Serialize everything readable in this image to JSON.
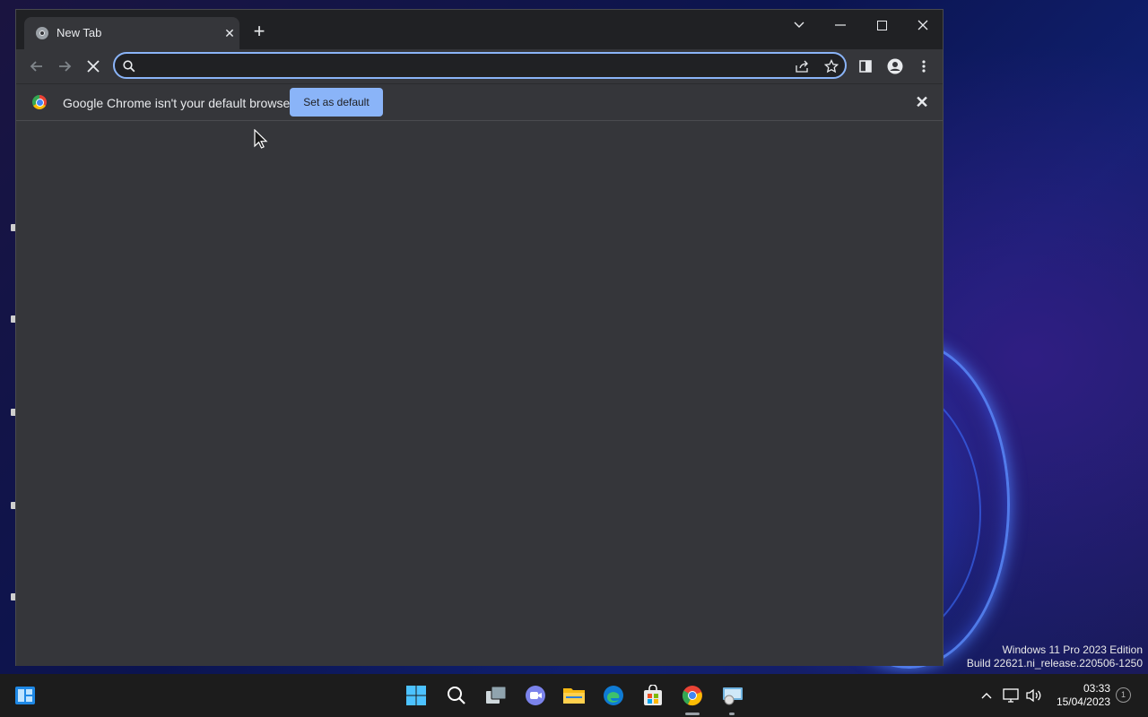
{
  "browser": {
    "tab": {
      "title": "New Tab",
      "close_glyph": "✕"
    },
    "new_tab_glyph": "+",
    "omnibox": {
      "value": "",
      "placeholder": ""
    },
    "infobar": {
      "message": "Google Chrome isn't your default browser",
      "button_label": "Set as default",
      "close_glyph": "✕"
    },
    "colors": {
      "accent": "#8ab4f8",
      "frame": "#202124",
      "toolbar": "#35363a"
    }
  },
  "desktop": {
    "watermark": {
      "line1": "Windows 11 Pro 2023 Edition",
      "line2": "Build 22621.ni_release.220506-1250"
    }
  },
  "taskbar": {
    "icons": [
      "windows-start-icon",
      "search-icon",
      "task-view-icon",
      "chat-icon",
      "file-explorer-icon",
      "edge-icon",
      "store-icon",
      "chrome-icon",
      "network-drive-icon"
    ],
    "clock": {
      "time": "03:33",
      "date": "15/04/2023"
    },
    "notification_count": "1"
  }
}
